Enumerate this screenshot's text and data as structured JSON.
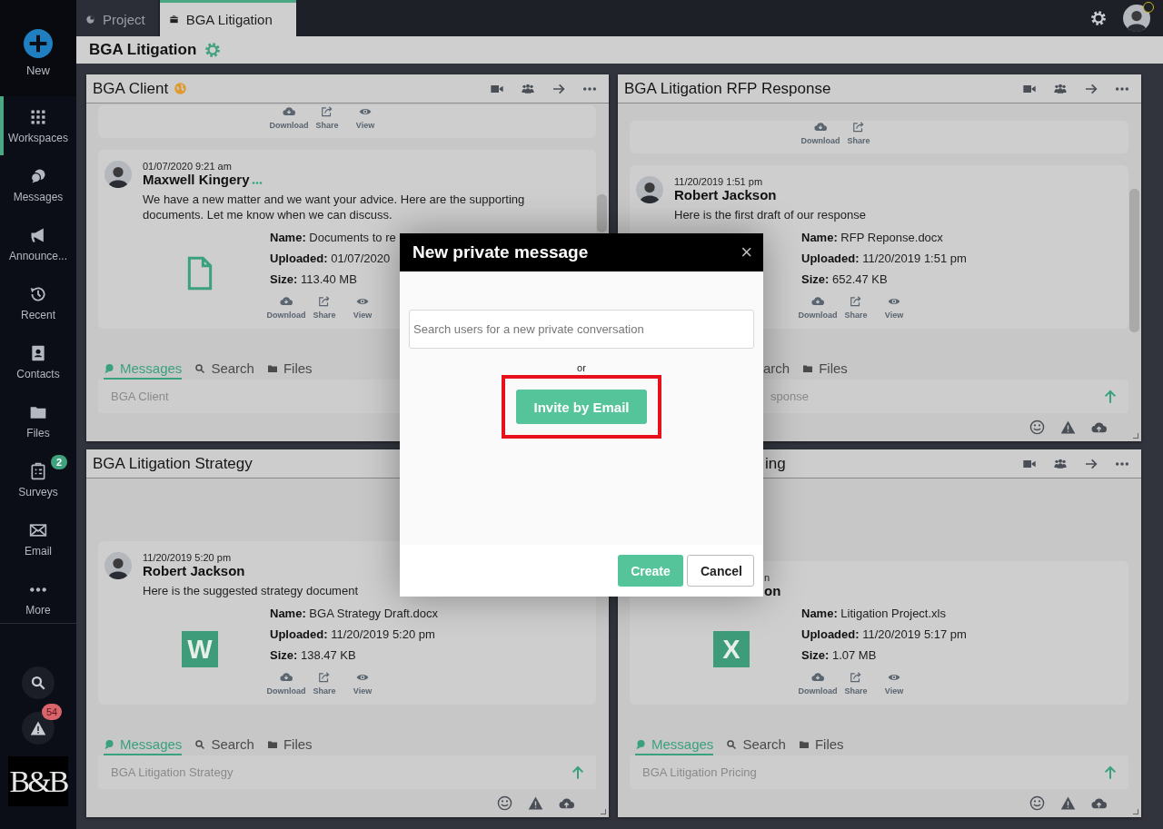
{
  "sidebar": {
    "items": [
      {
        "kind": "new",
        "label": "New",
        "selected": false
      },
      {
        "kind": "workspaces",
        "label": "Workspaces",
        "selected": true
      },
      {
        "kind": "messages",
        "label": "Messages",
        "selected": false
      },
      {
        "kind": "announcements",
        "label": "Announce...",
        "selected": false
      },
      {
        "kind": "recent",
        "label": "Recent",
        "selected": false
      },
      {
        "kind": "contacts",
        "label": "Contacts",
        "selected": false
      },
      {
        "kind": "files",
        "label": "Files",
        "selected": false
      },
      {
        "kind": "surveys",
        "label": "Surveys",
        "selected": false,
        "badge": "2"
      },
      {
        "kind": "email",
        "label": "Email",
        "selected": false
      },
      {
        "kind": "more",
        "label": "More",
        "selected": false
      }
    ],
    "tools": [
      {
        "kind": "search"
      },
      {
        "kind": "alerts",
        "badge": "54"
      }
    ],
    "logo": "B&B"
  },
  "tabs": [
    {
      "kind": "project",
      "label": "Project",
      "selected": false
    },
    {
      "kind": "workspace",
      "label": "BGA Litigation",
      "selected": true
    }
  ],
  "workspace": {
    "title": "BGA Litigation"
  },
  "panels": [
    {
      "title": "BGA Client",
      "external": true,
      "preview_actions": [
        {
          "kind": "download",
          "label": "Download"
        },
        {
          "kind": "share",
          "label": "Share"
        },
        {
          "kind": "view",
          "label": "View"
        }
      ],
      "message": {
        "avatar": true,
        "time": "01/07/2020 9:21 am",
        "author": "Maxwell Kingery",
        "ellipsis": true,
        "text": "We have a new matter and we want your advice. Here are the supporting documents. Let me know when we can discuss.",
        "file": {
          "kind": "generic"
        },
        "details": [
          {
            "label": "Name:",
            "value": "Documents to re"
          },
          {
            "label": "Uploaded:",
            "value": "01/07/2020"
          },
          {
            "label": "Size:",
            "value": "113.40 MB"
          }
        ],
        "actions": [
          {
            "kind": "download",
            "label": "Download"
          },
          {
            "kind": "share",
            "label": "Share"
          },
          {
            "kind": "view",
            "label": "View"
          }
        ]
      },
      "tabs": [
        {
          "kind": "messages",
          "label": "Messages",
          "selected": true
        },
        {
          "kind": "search",
          "label": "Search",
          "selected": false
        },
        {
          "kind": "files",
          "label": "Files",
          "selected": false
        }
      ],
      "input": {
        "placeholder": "BGA Client"
      }
    },
    {
      "title": "BGA Litigation RFP Response",
      "preview_actions": [
        {
          "kind": "download",
          "label": "Download"
        },
        {
          "kind": "share",
          "label": "Share"
        }
      ],
      "message": {
        "avatar": true,
        "time": "11/20/2019 1:51 pm",
        "author": "Robert Jackson",
        "text": "Here is the first draft of our response",
        "details": [
          {
            "label": "Name:",
            "value": "RFP Reponse.docx"
          },
          {
            "label": "Uploaded:",
            "value": "11/20/2019 1:51 pm"
          },
          {
            "label": "Size:",
            "value": "652.47 KB"
          }
        ],
        "actions": [
          {
            "kind": "download",
            "label": "Download"
          },
          {
            "kind": "share",
            "label": "Share"
          },
          {
            "kind": "view",
            "label": "View"
          }
        ]
      },
      "tabs": [
        {
          "kind": "search",
          "label": "arch",
          "selected": false
        },
        {
          "kind": "files",
          "label": "Files",
          "selected": false
        }
      ],
      "input": {
        "placeholder": "sponse"
      }
    },
    {
      "title": "BGA Litigation Strategy",
      "message": {
        "avatar": true,
        "time": "11/20/2019 5:20 pm",
        "author": "Robert Jackson",
        "text": "Here is the suggested strategy document",
        "file": {
          "kind": "word",
          "letter": "W"
        },
        "details": [
          {
            "label": "Name:",
            "value": "BGA Strategy Draft.docx"
          },
          {
            "label": "Uploaded:",
            "value": "11/20/2019 5:20 pm"
          },
          {
            "label": "Size:",
            "value": "138.47 KB"
          }
        ],
        "actions": [
          {
            "kind": "download",
            "label": "Download"
          },
          {
            "kind": "share",
            "label": "Share"
          },
          {
            "kind": "view",
            "label": "View"
          }
        ]
      },
      "tabs": [
        {
          "kind": "messages",
          "label": "Messages",
          "selected": true
        },
        {
          "kind": "search",
          "label": "Search",
          "selected": false
        },
        {
          "kind": "files",
          "label": "Files",
          "selected": false
        }
      ],
      "input": {
        "placeholder": "BGA Litigation Strategy"
      }
    },
    {
      "title": "ing",
      "message": {
        "time": "n",
        "author": "on",
        "file": {
          "kind": "excel",
          "letter": "X"
        },
        "details": [
          {
            "label": "Name:",
            "value": "Litigation Project.xls"
          },
          {
            "label": "Uploaded:",
            "value": "11/20/2019 5:17 pm"
          },
          {
            "label": "Size:",
            "value": "1.07 MB"
          }
        ],
        "actions": [
          {
            "kind": "download",
            "label": "Download"
          },
          {
            "kind": "share",
            "label": "Share"
          },
          {
            "kind": "view",
            "label": "View"
          }
        ]
      },
      "tabs": [
        {
          "kind": "messages",
          "label": "Messages",
          "selected": true
        },
        {
          "kind": "search",
          "label": "Search",
          "selected": false
        },
        {
          "kind": "files",
          "label": "Files",
          "selected": false
        }
      ],
      "input": {
        "placeholder": "BGA Litigation Pricing"
      }
    }
  ],
  "modal": {
    "title": "New private message",
    "close": "×",
    "search_placeholder": "Search users for a new private conversation",
    "separator": "or",
    "invite_button": "Invite by Email",
    "highlighted": true,
    "buttons": [
      {
        "kind": "primary",
        "label": "Create"
      },
      {
        "kind": "secondary",
        "label": "Cancel"
      }
    ]
  }
}
